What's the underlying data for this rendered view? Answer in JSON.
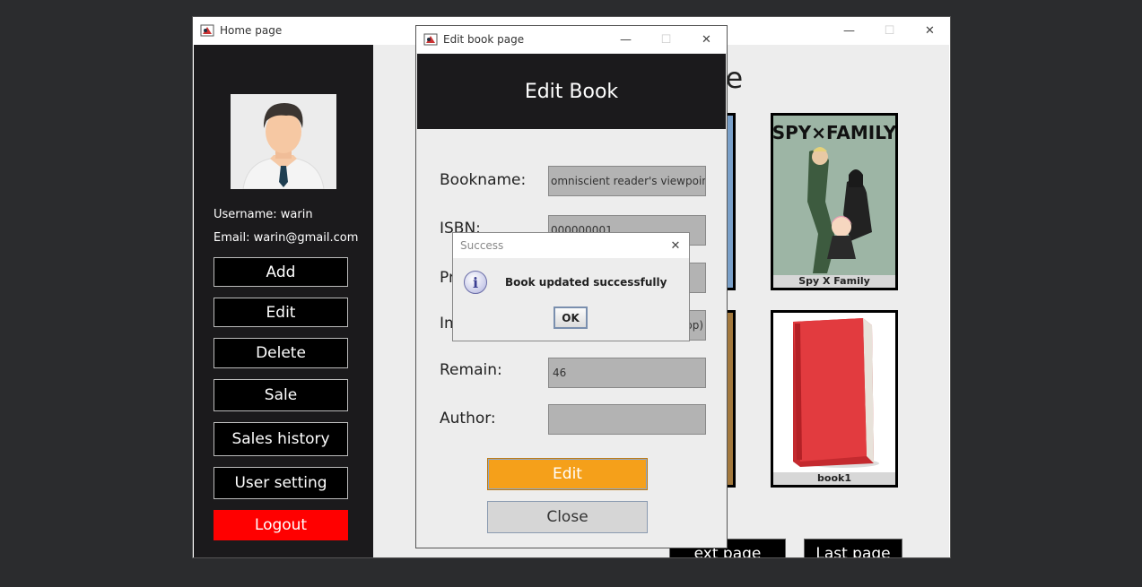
{
  "home": {
    "title": "Home page",
    "page_heading_fragment": "re",
    "user": {
      "username": "Username: warin",
      "email": "Email: warin@gmail.com"
    },
    "sidebar_buttons": [
      "Add",
      "Edit",
      "Delete",
      "Sale",
      "Sales history",
      "User setting",
      "Logout"
    ],
    "books": [
      {
        "caption": "Spy X Family",
        "cover_text": "SPY×FAMILY"
      },
      {
        "caption": "book1"
      }
    ],
    "nav": {
      "next": "ext page",
      "last": "Last page"
    }
  },
  "edit_dialog": {
    "title": "Edit book page",
    "heading": "Edit Book",
    "labels": {
      "bookname": "Bookname:",
      "isbn": "ISBN:",
      "price": "Pr",
      "image": "Im",
      "remain": "Remain:",
      "author": "Author:"
    },
    "values": {
      "bookname": "omniscient reader's viewpoint",
      "isbn": "000000001",
      "image": "pp)",
      "remain": "46",
      "author": ""
    },
    "buttons": {
      "edit": "Edit",
      "close": "Close"
    }
  },
  "success_dialog": {
    "title": "Success",
    "message": "Book updated successfully",
    "ok": "OK"
  },
  "colors": {
    "sidebar": "#1b1a1c",
    "logout": "#ff0000",
    "edit_button": "#f5a01a",
    "field": "#b3b3b3"
  }
}
